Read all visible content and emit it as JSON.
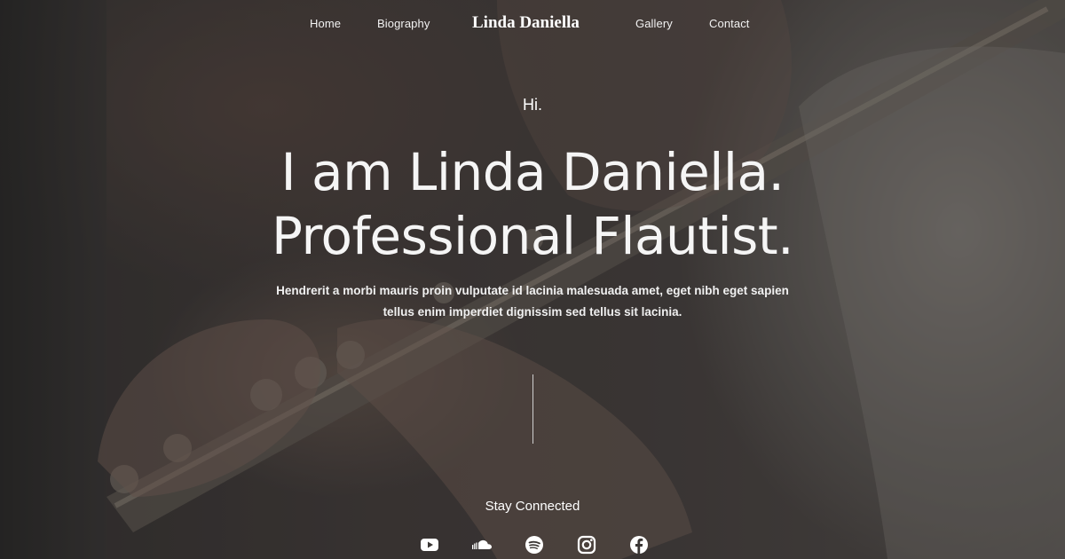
{
  "nav": {
    "links": [
      "Home",
      "Biography",
      "Gallery",
      "Contact"
    ],
    "brand": "Linda Daniella"
  },
  "hero": {
    "greeting": "Hi.",
    "headline_line1": "I am Linda Daniella.",
    "headline_line2": "Professional Flautist.",
    "description_line1": "Hendrerit a morbi mauris proin vulputate id lacinia malesuada amet, eget nibh eget sapien",
    "description_line2": "tellus enim imperdiet dignissim sed tellus sit lacinia."
  },
  "footer": {
    "stay_connected": "Stay Connected",
    "social_icons": [
      "youtube-icon",
      "soundcloud-icon",
      "spotify-icon",
      "instagram-icon",
      "facebook-icon"
    ]
  },
  "colors": {
    "text": "#ffffff",
    "overlay": "#141414"
  }
}
